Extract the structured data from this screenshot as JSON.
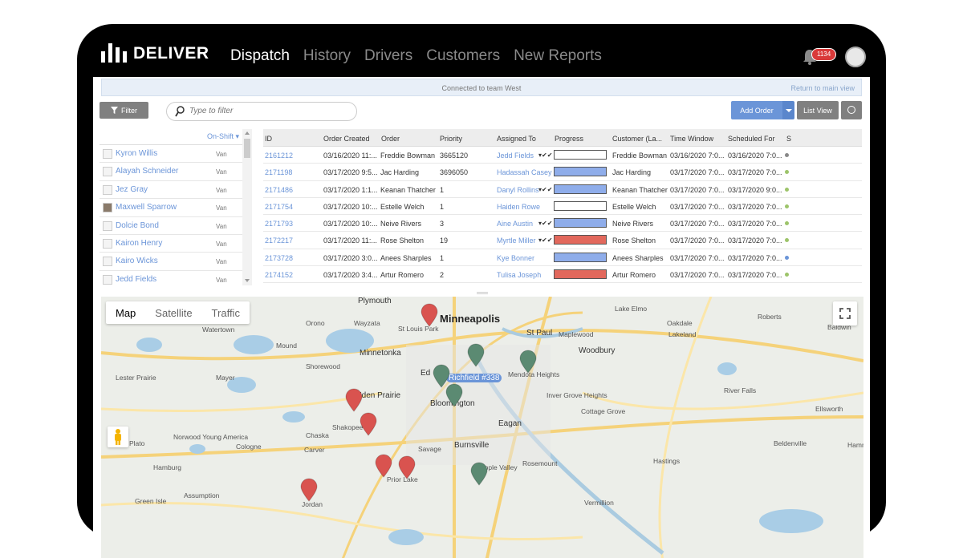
{
  "brand": {
    "name": "DELIVER"
  },
  "nav": {
    "items": [
      "Dispatch",
      "History",
      "Drivers",
      "Customers",
      "New Reports"
    ],
    "active": "Dispatch"
  },
  "notifications": {
    "count": "1134"
  },
  "connection": {
    "status": "Connected to team West",
    "return_link": "Return to main view"
  },
  "toolbar": {
    "filter_label": "Filter",
    "search_placeholder": "Type to filter",
    "add_order_label": "Add Order",
    "list_view_label": "List View"
  },
  "drivers": {
    "header": "On-Shift",
    "items": [
      {
        "name": "Kyron Willis",
        "vehicle": "Van"
      },
      {
        "name": "Alayah Schneider",
        "vehicle": "Van"
      },
      {
        "name": "Jez Gray",
        "vehicle": "Van"
      },
      {
        "name": "Maxwell Sparrow",
        "vehicle": "Van"
      },
      {
        "name": "Dolcie Bond",
        "vehicle": "Van"
      },
      {
        "name": "Kairon Henry",
        "vehicle": "Van"
      },
      {
        "name": "Kairo Wicks",
        "vehicle": "Van"
      },
      {
        "name": "Jedd Fields",
        "vehicle": "Van"
      }
    ]
  },
  "orders": {
    "columns": [
      "ID",
      "Order Created",
      "Order",
      "Priority",
      "Assigned To",
      "Progress",
      "Customer (La...",
      "Time Window",
      "Scheduled For",
      "S"
    ],
    "rows": [
      {
        "id": "2161212",
        "created": "03/16/2020 11:...",
        "order": "Freddie Bowman",
        "priority": "3665120",
        "assigned": "Jedd Fields",
        "checks": true,
        "progress": "empty",
        "customer": "Freddie Bowman",
        "window": "03/16/2020 7:0...",
        "scheduled": "03/16/2020 7:0...",
        "status": "#888888"
      },
      {
        "id": "2171198",
        "created": "03/17/2020 9:5...",
        "order": "Jac Harding",
        "priority": "3696050",
        "assigned": "Hadassah Casey",
        "checks": false,
        "progress": "blue",
        "customer": "Jac Harding",
        "window": "03/17/2020 7:0...",
        "scheduled": "03/17/2020 7:0...",
        "status": "#9dc46a"
      },
      {
        "id": "2171486",
        "created": "03/17/2020 1:1...",
        "order": "Keanan Thatcher",
        "priority": "1",
        "assigned": "Danyl Rollins",
        "checks": true,
        "progress": "blue",
        "customer": "Keanan Thatcher",
        "window": "03/17/2020 7:0...",
        "scheduled": "03/17/2020 9:0...",
        "status": "#9dc46a"
      },
      {
        "id": "2171754",
        "created": "03/17/2020 10:...",
        "order": "Estelle Welch",
        "priority": "1",
        "assigned": "Haiden Rowe",
        "checks": false,
        "progress": "empty",
        "customer": "Estelle Welch",
        "window": "03/17/2020 7:0...",
        "scheduled": "03/17/2020 7:0...",
        "status": "#9dc46a"
      },
      {
        "id": "2171793",
        "created": "03/17/2020 10:...",
        "order": "Neive Rivers",
        "priority": "3",
        "assigned": "Aine Austin",
        "checks": true,
        "progress": "blue",
        "customer": "Neive Rivers",
        "window": "03/17/2020 7:0...",
        "scheduled": "03/17/2020 7:0...",
        "status": "#9dc46a"
      },
      {
        "id": "2172217",
        "created": "03/17/2020 11:...",
        "order": "Rose Shelton",
        "priority": "19",
        "assigned": "Myrtle Miller",
        "checks": true,
        "progress": "red",
        "customer": "Rose Shelton",
        "window": "03/17/2020 7:0...",
        "scheduled": "03/17/2020 7:0...",
        "status": "#9dc46a"
      },
      {
        "id": "2173728",
        "created": "03/17/2020 3:0...",
        "order": "Anees Sharples",
        "priority": "1",
        "assigned": "Kye Bonner",
        "checks": false,
        "progress": "blue",
        "customer": "Anees Sharples",
        "window": "03/17/2020 7:0...",
        "scheduled": "03/17/2020 7:0...",
        "status": "#6b95d8"
      },
      {
        "id": "2174152",
        "created": "03/17/2020 3:4...",
        "order": "Artur Romero",
        "priority": "2",
        "assigned": "Tulisa Joseph",
        "checks": false,
        "progress": "red",
        "customer": "Artur Romero",
        "window": "03/17/2020 7:0...",
        "scheduled": "03/17/2020 7:0...",
        "status": "#9dc46a"
      }
    ]
  },
  "progress_colors": {
    "blue": "#8fadea",
    "red": "#e2685c",
    "empty": "#ffffff"
  },
  "map": {
    "tabs": [
      "Map",
      "Satellite",
      "Traffic"
    ],
    "active_tab": "Map",
    "pin_colors": {
      "red": "#d9534f",
      "green": "#5b8a72"
    },
    "labels": [
      "Plymouth",
      "Minneapolis",
      "St Louis Park",
      "St Paul",
      "Orono",
      "Wayzata",
      "Mound",
      "Minnetonka",
      "Shorewood",
      "Lake Elmo",
      "Oakdale",
      "Lakeland",
      "Roberts",
      "Baldwin",
      "Woodbury",
      "Maplewood",
      "Mendota Heights",
      "Inver Grove Heights",
      "Cottage Grove",
      "Eagan",
      "Burnsville",
      "Savage",
      "Shakopee",
      "Chaska",
      "Carver",
      "Apple Valley",
      "Rosemount",
      "Prior Lake",
      "Jordan",
      "Hastings",
      "River Falls",
      "Ellsworth",
      "Beldenville",
      "Hammond",
      "Hamburg",
      "Norwood Young America",
      "Cologne",
      "Plato",
      "Green Isle",
      "Assumption",
      "Lester Prairie",
      "Mayer",
      "Watertown",
      "Vermillion",
      "Eden Prairie",
      "Bloomington",
      "Ed",
      "Richfield #338"
    ]
  }
}
